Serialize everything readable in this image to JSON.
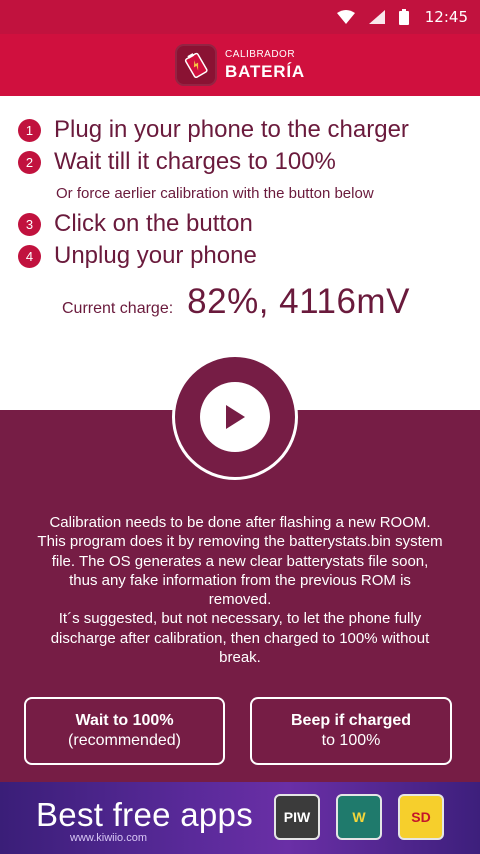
{
  "status_bar": {
    "time": "12:45"
  },
  "app_bar": {
    "logo_line1": "CALIBRADOR",
    "logo_line2": "BATERÍA"
  },
  "steps": [
    {
      "number": "1",
      "text": "Plug in your phone to the charger"
    },
    {
      "number": "2",
      "text": "Wait till it charges to 100%"
    },
    {
      "number": "3",
      "text": "Click on the button"
    },
    {
      "number": "4",
      "text": "Unplug your phone"
    }
  ],
  "step2_note": "Or force aerlier calibration with the button below",
  "charge": {
    "label": "Current charge:",
    "value": "82%, 4116mV"
  },
  "info_text": "Calibration needs to be done after flashing a new ROOM. This program does it by removing the batterystats.bin system file. The OS generates a new clear batterystats file soon, thus any fake information from the previous ROM is removed.\nIt´s suggested, but not necessary, to let the phone fully discharge after calibration, then charged to 100% without break.",
  "buttons": {
    "wait": {
      "line1": "Wait to 100%",
      "line2": "(recommended)"
    },
    "beep": {
      "line1": "Beep if charged",
      "line2": "to 100%"
    }
  },
  "ad": {
    "title": "Best free apps",
    "subtitle": "www.kiwiio.com",
    "icons": [
      "PIW",
      "W",
      "SD"
    ]
  },
  "colors": {
    "status_bar": "#c1123e",
    "app_bar": "#d0103e",
    "panel": "#761d45",
    "text": "#6a1a3c"
  }
}
